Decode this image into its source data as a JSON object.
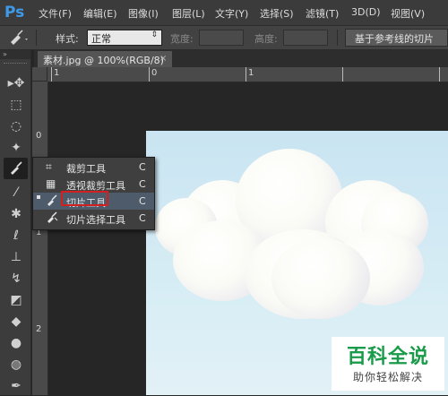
{
  "app": {
    "logo": "Ps"
  },
  "menu": [
    "文件(F)",
    "编辑(E)",
    "图像(I)",
    "图层(L)",
    "文字(Y)",
    "选择(S)",
    "滤镜(T)",
    "3D(D)",
    "视图(V)"
  ],
  "options_bar": {
    "style_label": "样式:",
    "style_value": "正常",
    "width_label": "宽度:",
    "height_label": "高度:",
    "guides_button": "基于参考线的切片"
  },
  "document": {
    "tab_title": "素材.jpg @ 100%(RGB/8)",
    "close": "×"
  },
  "rulers": {
    "top": [
      "1",
      "0",
      "1"
    ],
    "left": [
      "0",
      "1",
      "2"
    ]
  },
  "flyout": {
    "items": [
      {
        "label": "裁剪工具",
        "shortcut": "C",
        "icon": "crop-icon"
      },
      {
        "label": "透视裁剪工具",
        "shortcut": "C",
        "icon": "perspective-crop-icon"
      },
      {
        "label": "切片工具",
        "shortcut": "C",
        "icon": "slice-icon",
        "selected": true
      },
      {
        "label": "切片选择工具",
        "shortcut": "C",
        "icon": "slice-select-icon"
      }
    ]
  },
  "toolbar": {
    "tools": [
      "move-icon",
      "marquee-icon",
      "lasso-icon",
      "magic-wand-icon",
      "slice-tool-icon",
      "eyedropper-icon",
      "healing-brush-icon",
      "brush-icon",
      "clone-stamp-icon",
      "history-brush-icon",
      "eraser-icon",
      "paint-bucket-icon",
      "blur-icon",
      "dodge-icon",
      "pen-icon"
    ]
  },
  "watermark": {
    "title": "百科全说",
    "subtitle": "助你轻松解决"
  },
  "colors": {
    "highlight": "#d21f1f",
    "watermark_green": "#1a9b49",
    "ps_blue": "#3e9ae8"
  }
}
